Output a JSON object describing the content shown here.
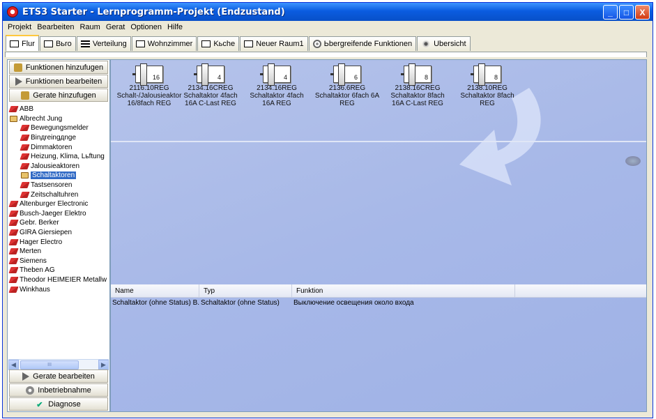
{
  "window": {
    "title": "ETS3 Starter - Lernprogramm-Projekt (Endzustand)",
    "controls": {
      "minimize": "_",
      "maximize": "□",
      "close": "X"
    }
  },
  "menu": [
    "Projekt",
    "Bearbeiten",
    "Raum",
    "Gerat",
    "Optionen",
    "Hilfe"
  ],
  "tabs": [
    {
      "label": "Flur",
      "icon": "room-icon",
      "active": true
    },
    {
      "label": "Bьro",
      "icon": "room-icon",
      "active": false
    },
    {
      "label": "Verteilung",
      "icon": "distribution-icon",
      "active": false
    },
    {
      "label": "Wohnzimmer",
      "icon": "room-icon",
      "active": false
    },
    {
      "label": "Kьche",
      "icon": "room-icon",
      "active": false
    },
    {
      "label": "Neuer Raum1",
      "icon": "room-icon",
      "active": false
    },
    {
      "label": "Ьbergreifende Funktionen",
      "icon": "functions-icon",
      "active": false
    },
    {
      "label": "Ubersicht",
      "icon": "overview-icon",
      "active": false
    }
  ],
  "sidebar": {
    "top_buttons": [
      "Funktionen hinzufugen",
      "Funktionen bearbeiten",
      "Gerate hinzufugen"
    ],
    "tree": [
      {
        "label": "ABB",
        "level": 1,
        "icon": "manufacturer-icon"
      },
      {
        "label": "Albrecht Jung",
        "level": 1,
        "icon": "book-icon"
      },
      {
        "label": "Bewegungsmelder",
        "level": 2,
        "icon": "manufacturer-icon"
      },
      {
        "label": "Binдreingдnge",
        "level": 2,
        "icon": "manufacturer-icon"
      },
      {
        "label": "Dimmaktoren",
        "level": 2,
        "icon": "manufacturer-icon"
      },
      {
        "label": "Heizung, Klima, Lьftung",
        "level": 2,
        "icon": "manufacturer-icon"
      },
      {
        "label": "Jalousieaktoren",
        "level": 2,
        "icon": "manufacturer-icon"
      },
      {
        "label": "Schaltaktoren",
        "level": 2,
        "icon": "book-icon",
        "selected": true
      },
      {
        "label": "Tastsensoren",
        "level": 2,
        "icon": "manufacturer-icon"
      },
      {
        "label": "Zeitschaltuhren",
        "level": 2,
        "icon": "manufacturer-icon"
      },
      {
        "label": "Altenburger Electronic",
        "level": 1,
        "icon": "manufacturer-icon"
      },
      {
        "label": "Busch-Jaeger Elektro",
        "level": 1,
        "icon": "manufacturer-icon"
      },
      {
        "label": "Gebr. Berker",
        "level": 1,
        "icon": "manufacturer-icon"
      },
      {
        "label": "GIRA Giersiepen",
        "level": 1,
        "icon": "manufacturer-icon"
      },
      {
        "label": "Hager Electro",
        "level": 1,
        "icon": "manufacturer-icon"
      },
      {
        "label": "Merten",
        "level": 1,
        "icon": "manufacturer-icon"
      },
      {
        "label": "Siemens",
        "level": 1,
        "icon": "manufacturer-icon"
      },
      {
        "label": "Theben AG",
        "level": 1,
        "icon": "manufacturer-icon"
      },
      {
        "label": "Theodor HEIMEIER Metallw",
        "level": 1,
        "icon": "manufacturer-icon"
      },
      {
        "label": "Winkhaus",
        "level": 1,
        "icon": "manufacturer-icon"
      }
    ],
    "scroll_thumb_label": "III",
    "bottom_buttons": [
      "Gerate bearbeiten",
      "Inbetriebnahme",
      "Diagnose"
    ]
  },
  "devices": [
    {
      "channels": "16",
      "code": "2116.10REG",
      "line1": "Schalt-/Jalousieaktor",
      "line2": "16/8fach REG"
    },
    {
      "channels": "4",
      "code": "2134.16CREG",
      "line1": "Schaltaktor 4fach",
      "line2": "16A C-Last REG"
    },
    {
      "channels": "4",
      "code": "2134.16REG",
      "line1": "Schaltaktor 4fach",
      "line2": "16A REG"
    },
    {
      "channels": "6",
      "code": "2136.6REG",
      "line1": "Schaltaktor 6fach 6A",
      "line2": "REG"
    },
    {
      "channels": "8",
      "code": "2138.16CREG",
      "line1": "Schaltaktor 8fach",
      "line2": "16A C-Last REG"
    },
    {
      "channels": "8",
      "code": "2138.10REG",
      "line1": "Schaltaktor 8fach",
      "line2": "REG"
    }
  ],
  "table": {
    "columns": [
      "Name",
      "Typ",
      "Funktion"
    ],
    "rows": [
      [
        "Schaltaktor (ohne Status) B...",
        "Schaltaktor (ohne Status)",
        "Выключение освещения около входа"
      ]
    ]
  }
}
